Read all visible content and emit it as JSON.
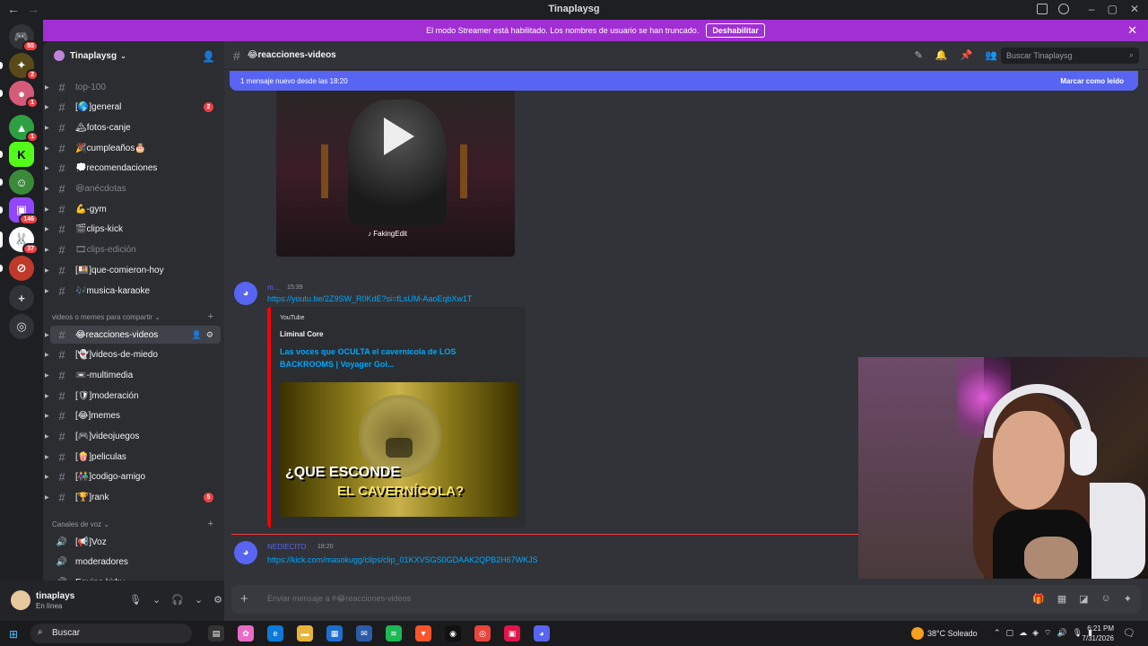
{
  "window": {
    "title": "Tinaplaysg"
  },
  "banner": {
    "text": "El modo Streamer está habilitado. Los nombres de usuario se han truncado.",
    "button": "Deshabilitar"
  },
  "server_badges": [
    "55",
    "2",
    "1",
    "1",
    "146",
    "37"
  ],
  "guild": {
    "name": "Tinaplaysg"
  },
  "channels": [
    {
      "name": "top-100",
      "muted": true
    },
    {
      "name": "[🌎]general",
      "badge": "2"
    },
    {
      "name": "🏔fotos-canje"
    },
    {
      "name": "🎉cumpleaños🎂"
    },
    {
      "name": "💭recomendaciones"
    },
    {
      "name": "😆anécdotas",
      "muted": true
    },
    {
      "name": "💪-gym"
    },
    {
      "name": "🎬clips-kick"
    },
    {
      "name": "🎞clips-edición",
      "muted": true
    },
    {
      "name": "[🍱]que-comieron-hoy"
    },
    {
      "name": "🎶musica-karaoke"
    }
  ],
  "category_videos": "videos o memes para compartir",
  "channels2": [
    {
      "name": "😂reacciones-videos",
      "active": true
    },
    {
      "name": "[👻]videos-de-miedo"
    },
    {
      "name": "📼-multimedia"
    },
    {
      "name": "[🛡]moderación"
    },
    {
      "name": "[😂]memes"
    },
    {
      "name": "[🎮]videojuegos"
    },
    {
      "name": "[🍿]peliculas"
    },
    {
      "name": "[👫]codigo-amigo"
    },
    {
      "name": "[🏆]rank",
      "badge": "5"
    }
  ],
  "category_voice": "Canales de voz",
  "voice": [
    {
      "name": "[📢]Voz"
    },
    {
      "name": "moderadores"
    },
    {
      "name": "Equipo kirby"
    }
  ],
  "user": {
    "name": "tinaplays",
    "status": "En línea"
  },
  "header": {
    "channel": "😂reacciones-videos",
    "search_placeholder": "Buscar Tinaplaysg"
  },
  "new_bar": {
    "text": "1 mensaje nuevo desde las 18:20",
    "action": "Marcar como leído"
  },
  "video1": {
    "watermark": "FakingEdit"
  },
  "msg1": {
    "author": "m...",
    "time": "15:39",
    "link": "https://youtu.be/2Z9SW_R0KdE?si=fLsUM-AaoEqbXw1T",
    "embed_provider": "YouTube",
    "embed_channel": "Liminal Core",
    "embed_title": "Las voces que OCULTA el cavernícola de LOS BACKROOMS | Voyager Gol...",
    "thumb_text1": "¿QUE ESCONDE",
    "thumb_text2": "EL CAVERNÍCOLA?"
  },
  "msg2": {
    "author": "NEDIECITO",
    "time": "18:20",
    "link": "https://kick.com/masokugg/clips/clip_01KXVSGS0GDAAK2QPB2H67WKJS"
  },
  "composer": {
    "placeholder": "Enviar mensaje a #😂reacciones-videos"
  },
  "taskbar": {
    "search": "Buscar",
    "weather": "38°C  Soleado",
    "time": "6:21 PM",
    "date": "7/31/2026"
  }
}
